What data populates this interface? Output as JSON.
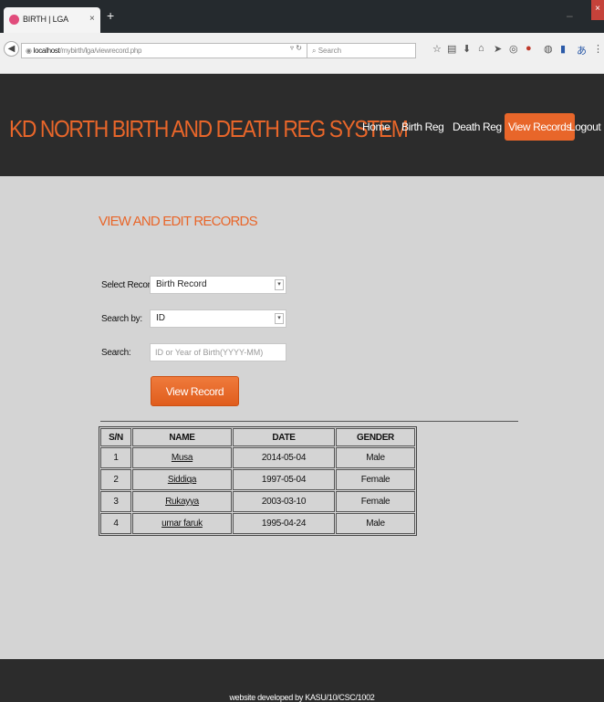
{
  "browser": {
    "tab_title": "BIRTH | LGA",
    "tab_close": "×",
    "new_tab": "+",
    "url_host": "localhost",
    "url_path": "/mybirth/lga/viewrecord.php",
    "search_placeholder": "Search"
  },
  "header": {
    "brand": "KD NORTH BIRTH AND DEATH REG SYSTEM",
    "menu": [
      "Home",
      "Birth Reg",
      "Death Reg",
      "View Records",
      "Logout"
    ],
    "active_menu": "View Records"
  },
  "main": {
    "title": "VIEW AND EDIT RECORDS",
    "select_record_label": "Select Record:",
    "select_record_value": "Birth Record",
    "search_by_label": "Search by:",
    "search_by_value": "ID",
    "search_label": "Search:",
    "search_placeholder": "ID or Year of Birth(YYYY-MM)",
    "view_button": "View Record"
  },
  "table": {
    "headers": [
      "S/N",
      "NAME",
      "DATE",
      "GENDER"
    ],
    "rows": [
      [
        "1",
        "Musa",
        "2014-05-04",
        "Male"
      ],
      [
        "2",
        "Siddiqa",
        "1997-05-04",
        "Female"
      ],
      [
        "3",
        "Rukayya",
        "2003-03-10",
        "Female"
      ],
      [
        "4",
        "umar faruk",
        "1995-04-24",
        "Male"
      ]
    ]
  },
  "footer": {
    "text": "website developed by KASU/10/CSC/1002"
  },
  "colors": {
    "accent": "#e8662a",
    "header_bg": "#2c2c2c",
    "page_bg": "#d4d4d4"
  }
}
